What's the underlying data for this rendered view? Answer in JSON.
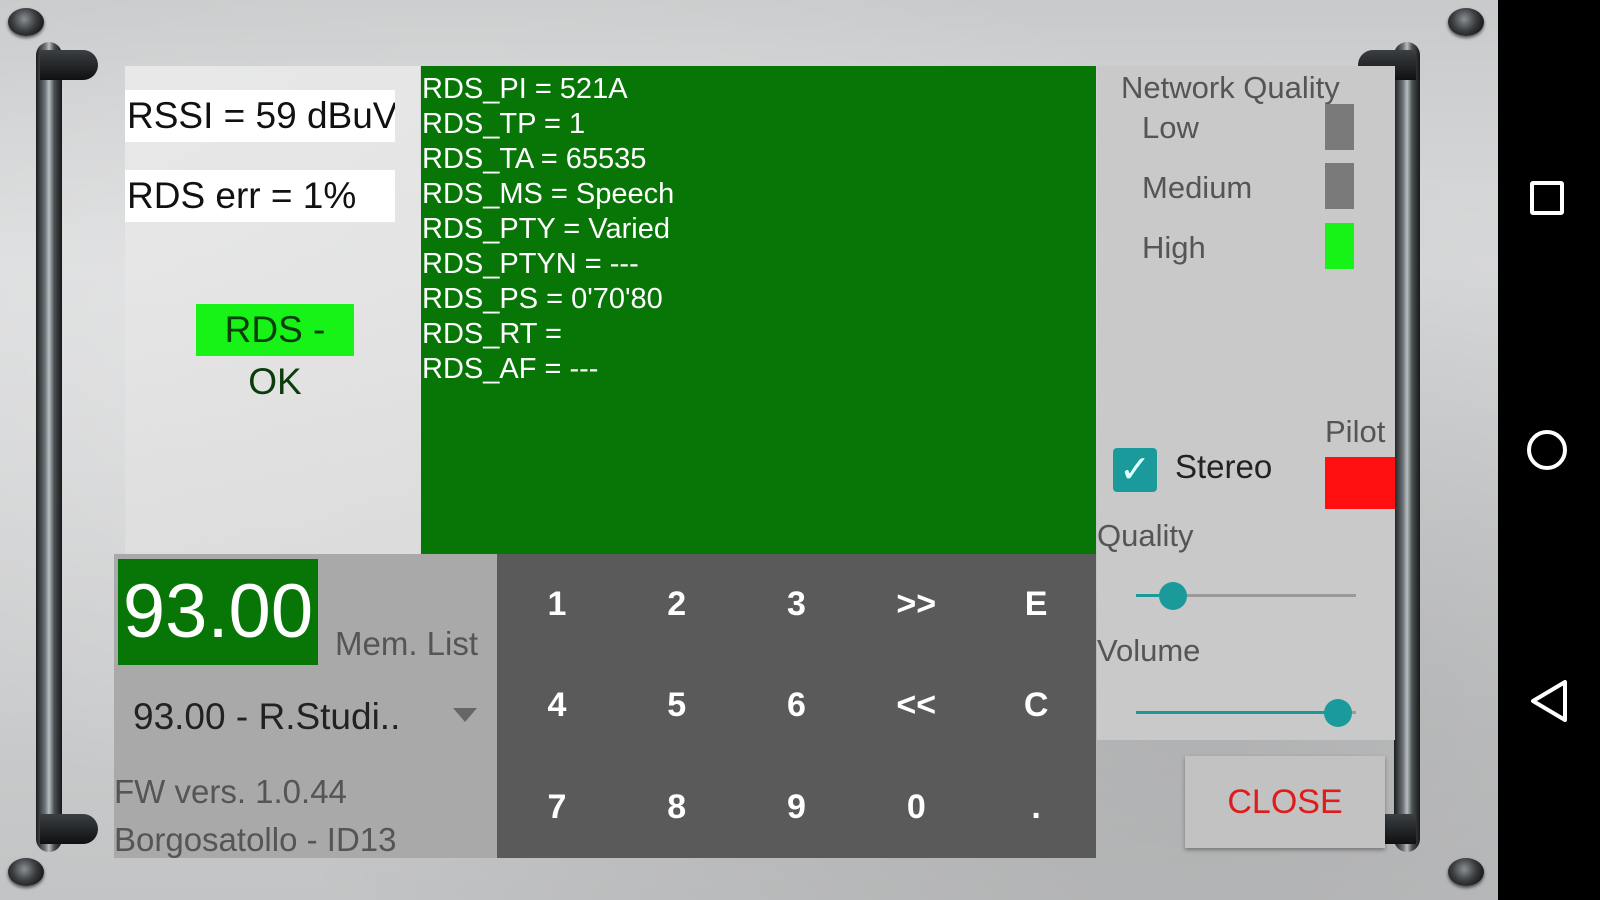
{
  "left_panel": {
    "rssi": "RSSI = 59 dBuV",
    "rds_err": "RDS err = 1%",
    "rds_status": "RDS - OK"
  },
  "rds": {
    "lines": [
      "RDS_PI = 521A",
      "RDS_TP = 1",
      "RDS_TA = 65535",
      "RDS_MS = Speech",
      "RDS_PTY = Varied",
      "RDS_PTYN = ---",
      "RDS_PS = 0'70'80",
      "RDS_RT =",
      "RDS_AF = ---"
    ]
  },
  "network_quality": {
    "title": "Network Quality",
    "low": "Low",
    "medium": "Medium",
    "high": "High",
    "colors": {
      "low": "#7a7a7a",
      "medium": "#7a7a7a",
      "high": "#17f217"
    }
  },
  "stereo": {
    "label": "Stereo",
    "checked": true
  },
  "pilot": {
    "label": "Pilot",
    "color": "#ff0f0f"
  },
  "quality": {
    "label": "Quality",
    "level": 0.17
  },
  "volume": {
    "label": "Volume",
    "level": 0.92
  },
  "frequency": {
    "display": "93.00",
    "mem_list": "Mem. List",
    "selected_station": "93.00 - R.Studi.."
  },
  "firmware": {
    "version": "FW vers. 1.0.44",
    "location": "Borgosatollo - ID13"
  },
  "keypad": {
    "keys": [
      "1",
      "2",
      "3",
      ">>",
      "E",
      "4",
      "5",
      "6",
      "<<",
      "C",
      "7",
      "8",
      "9",
      "0",
      "."
    ]
  },
  "close": "CLOSE",
  "accent": "#1a9a9a",
  "rds_bg": "#077607"
}
